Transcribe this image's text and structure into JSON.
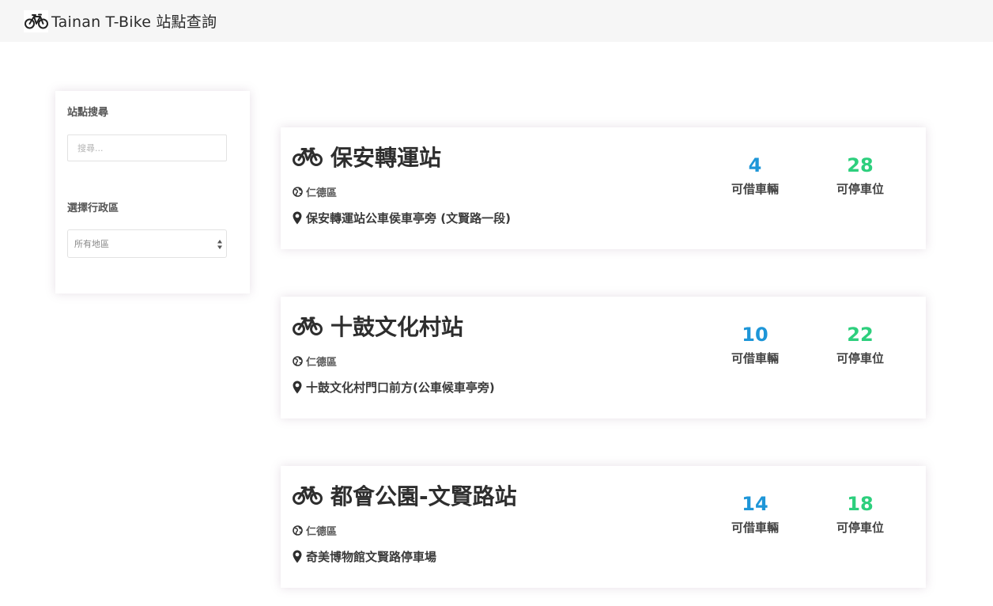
{
  "app": {
    "title": "Tainan T-Bike 站點查詢",
    "logo_icon": "bicycle-icon"
  },
  "sidebar": {
    "search_label": "站點搜尋",
    "search_placeholder": "搜尋...",
    "district_label": "選擇行政區",
    "district_selected": "所有地區"
  },
  "stations": [
    {
      "name": "保安轉運站",
      "district": "仁德區",
      "address": "保安轉運站公車侯車亭旁 (文賢路一段)",
      "available_bikes": "4",
      "available_bikes_label": "可借車輛",
      "empty_docks": "28",
      "empty_docks_label": "可停車位"
    },
    {
      "name": "十鼓文化村站",
      "district": "仁德區",
      "address": "十鼓文化村門口前方(公車候車亭旁)",
      "available_bikes": "10",
      "available_bikes_label": "可借車輛",
      "empty_docks": "22",
      "empty_docks_label": "可停車位"
    },
    {
      "name": "都會公園-文賢路站",
      "district": "仁德區",
      "address": "奇美博物館文賢路停車場",
      "available_bikes": "14",
      "available_bikes_label": "可借車輛",
      "empty_docks": "18",
      "empty_docks_label": "可停車位"
    }
  ],
  "colors": {
    "bikes_count": "#1e96d8",
    "docks_count": "#2dcf7d",
    "navbar_bg": "#f6f6f6"
  }
}
